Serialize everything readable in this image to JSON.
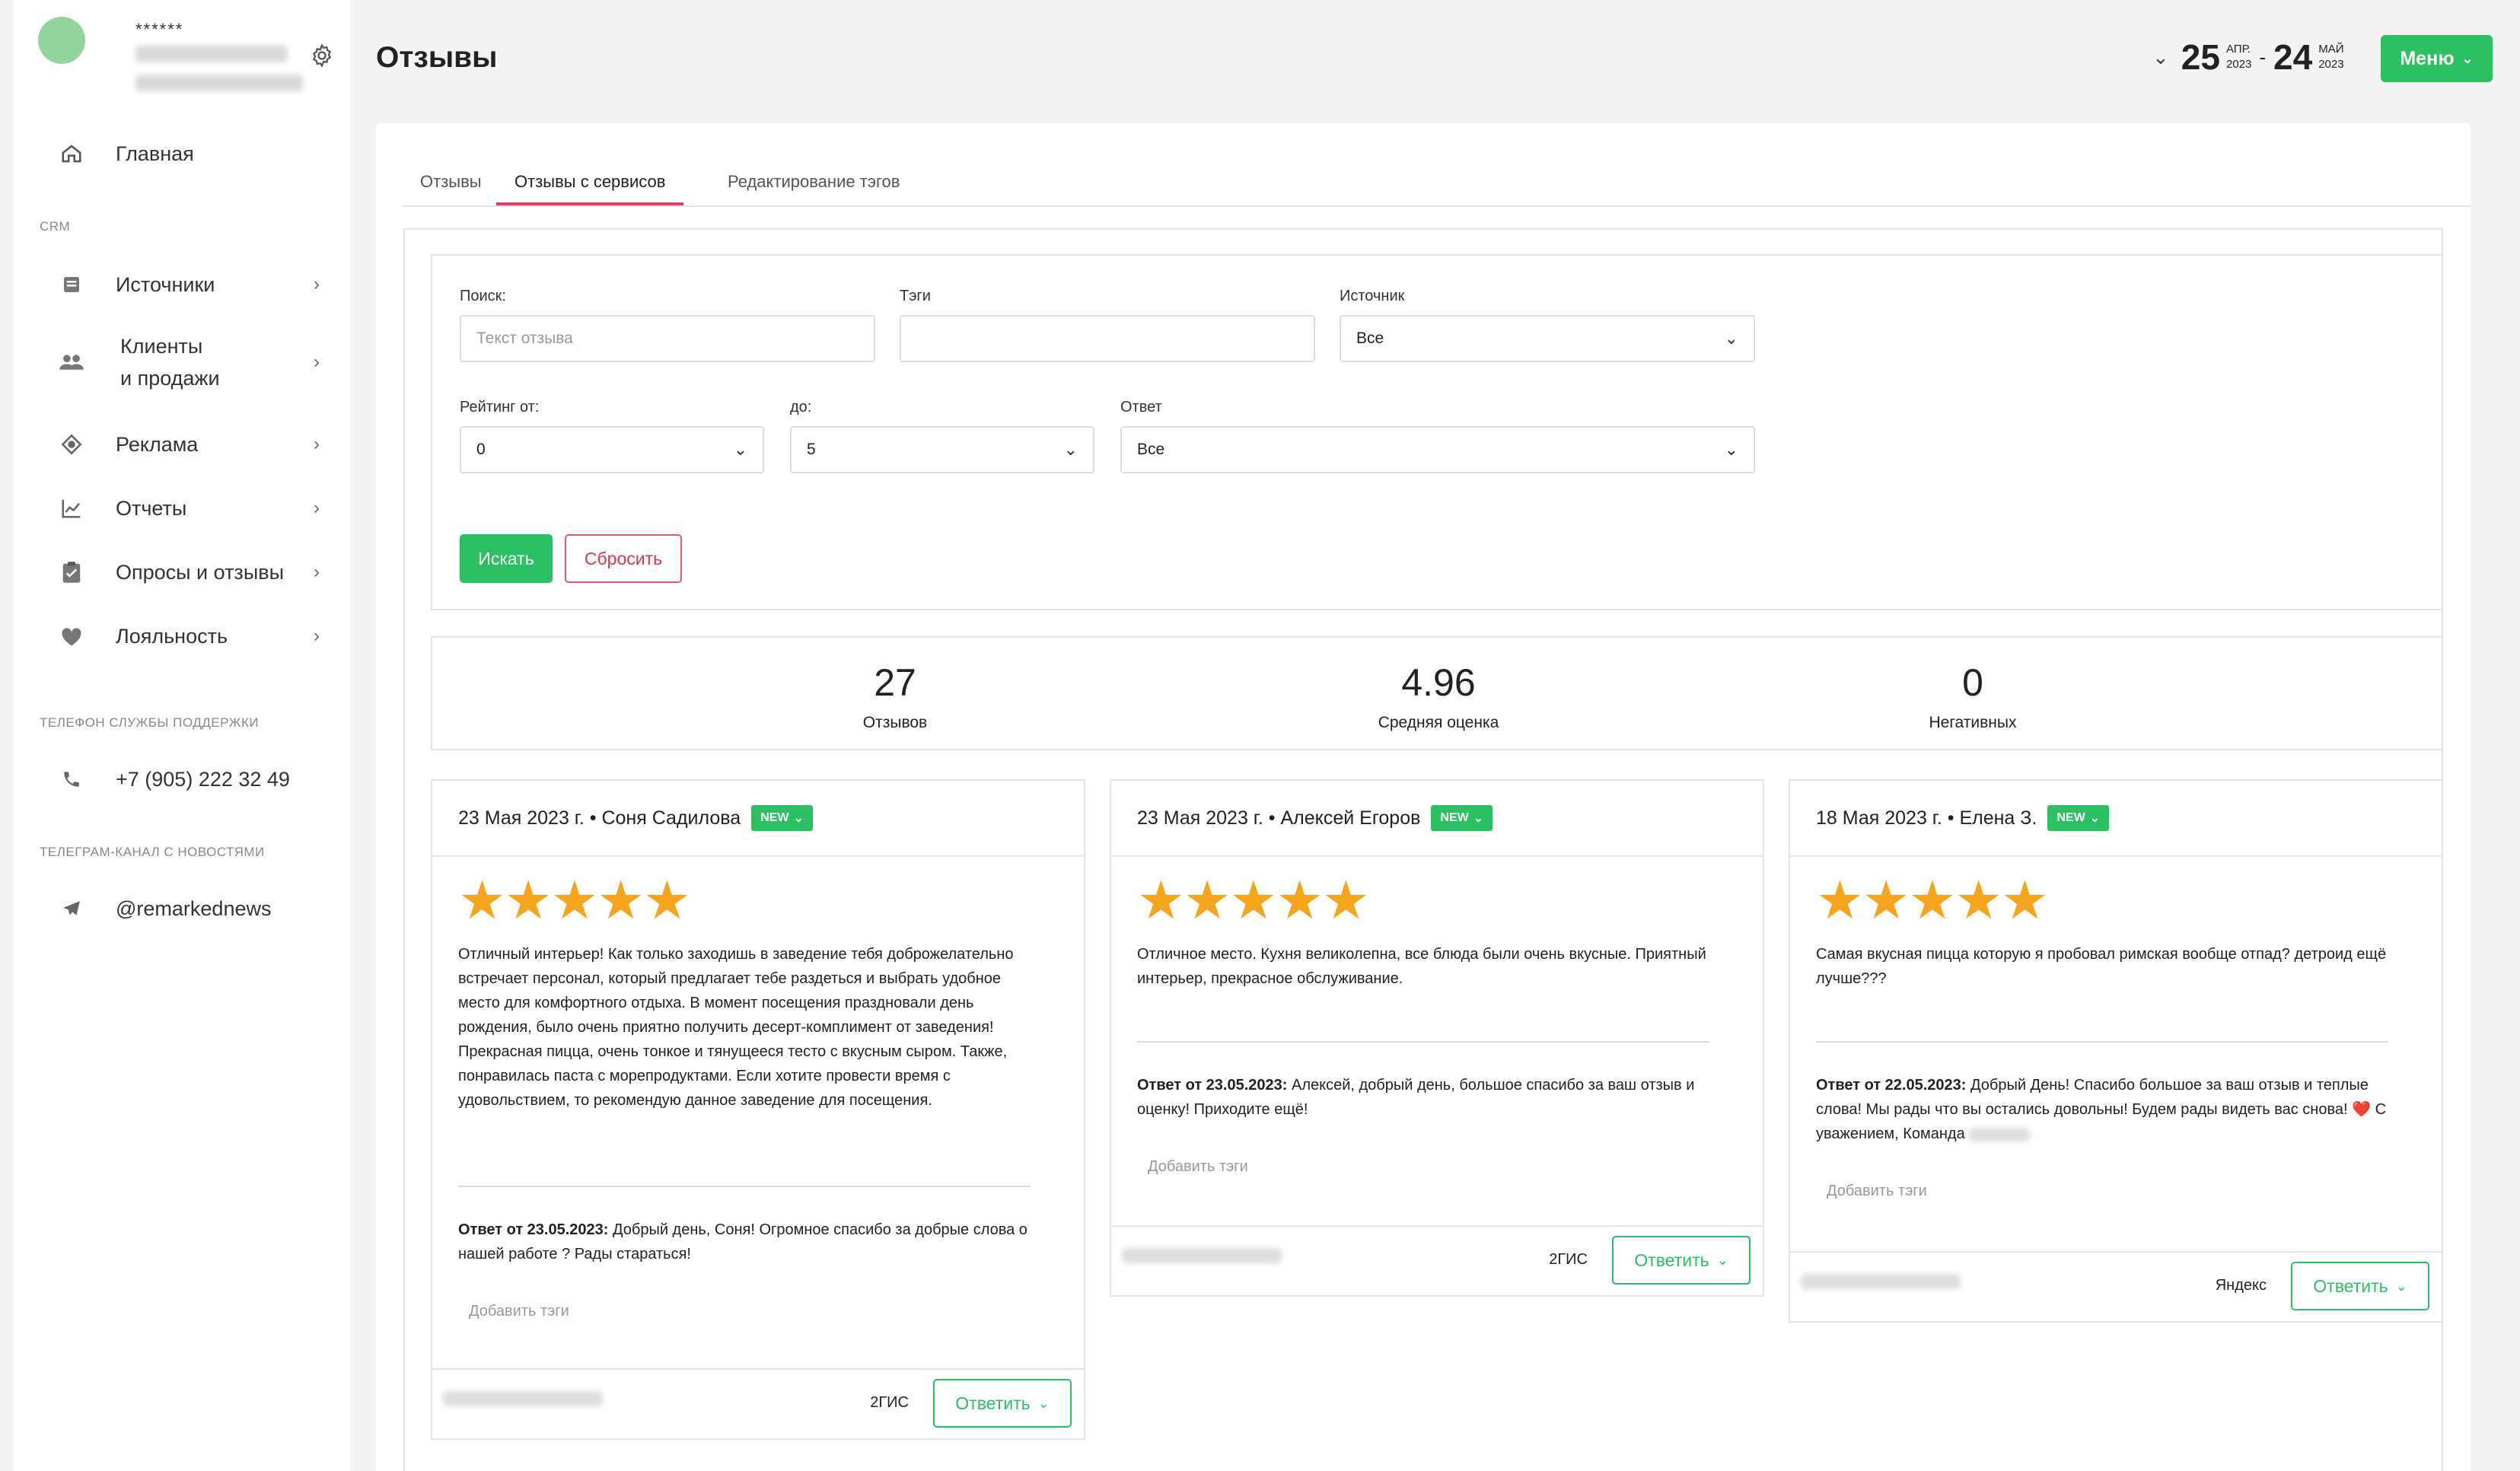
{
  "sidebar": {
    "user_mask": "******",
    "items": [
      {
        "label": "Главная",
        "icon": "home-icon"
      },
      {
        "label": "Источники",
        "icon": "sources-icon"
      },
      {
        "label": "Клиенты\nи продажи",
        "icon": "clients-icon"
      },
      {
        "label": "Реклама",
        "icon": "ads-icon"
      },
      {
        "label": "Отчеты",
        "icon": "reports-icon"
      },
      {
        "label": "Опросы и отзывы",
        "icon": "surveys-icon"
      },
      {
        "label": "Лояльность",
        "icon": "heart-icon"
      }
    ],
    "crm_section": "CRM",
    "support_section": "ТЕЛЕФОН СЛУЖБЫ ПОДДЕРЖКИ",
    "support_phone": "+7 (905) 222 32 49",
    "news_section": "ТЕЛЕГРАМ-КАНАЛ С НОВОСТЯМИ",
    "news_channel": "@remarkednews"
  },
  "header": {
    "title": "Отзывы",
    "date_from_day": "25",
    "date_from_month": "АПР.",
    "date_from_year": "2023",
    "date_dash": "-",
    "date_to_day": "24",
    "date_to_month": "МАЙ",
    "date_to_year": "2023",
    "menu_label": "Меню"
  },
  "tabs": [
    "Отзывы",
    "Отзывы с сервисов",
    "Редактирование тэгов"
  ],
  "filters": {
    "search_label": "Поиск:",
    "search_placeholder": "Текст отзыва",
    "tags_label": "Тэги",
    "source_label": "Источник",
    "source_value": "Все",
    "rating_from_label": "Рейтинг от:",
    "rating_from_value": "0",
    "rating_to_label": "до:",
    "rating_to_value": "5",
    "answer_label": "Ответ",
    "answer_value": "Все",
    "search_button": "Искать",
    "reset_button": "Сбросить"
  },
  "stats": [
    {
      "value": "27",
      "caption": "Отзывов"
    },
    {
      "value": "4.96",
      "caption": "Средняя оценка"
    },
    {
      "value": "0",
      "caption": "Негативных"
    }
  ],
  "reviews": [
    {
      "header": "23 Мая 2023 г.  • Соня Садилова",
      "badge": "NEW",
      "rating": 5,
      "stars": "★★★★★",
      "text": "Отличный интерьер! Как только заходишь в заведение тебя доброжелательно встречает персонал, который предлагает тебе раздеться и выбрать удобное место для комфортного отдыха. В момент посещения праздновали день рождения, было очень приятно получить десерт-комплимент от заведения! Прекрасная пицца, очень тонкое и тянущееся тесто с вкусным сыром. Также, понравилась паста с морепродуктами. Если хотите провести время с удовольствием, то рекомендую данное заведение для посещения.",
      "answer_prefix": "Ответ от 23.05.2023:",
      "answer_text": " Добрый день, Соня! Огромное спасибо за добрые слова о нашей работе ? Рады стараться!",
      "add_tags": "Добавить тэги",
      "source": "2ГИС",
      "reply_label": "Ответить"
    },
    {
      "header": "23 Мая 2023 г.  • Алексей Егоров",
      "badge": "NEW",
      "rating": 5,
      "stars": "★★★★★",
      "text": "Отличное место. Кухня великолепна, все блюда были очень вкусные. Приятный интерьер, прекрасное обслуживание.",
      "answer_prefix": "Ответ от 23.05.2023:",
      "answer_text": " Алексей, добрый день, большое спасибо за ваш отзыв и оценку! Приходите ещё!",
      "add_tags": "Добавить тэги",
      "source": "2ГИС",
      "reply_label": "Ответить"
    },
    {
      "header": "18 Мая 2023 г.  • Елена З.",
      "badge": "NEW",
      "rating": 5,
      "stars": "★★★★★",
      "text": "Самая вкусная пицца которую я пробовал римская вообще отпад? детроид ещё лучше???",
      "answer_prefix": "Ответ от 22.05.2023:",
      "answer_text": " Добрый День! Спасибо большое за ваш отзыв и теплые слова! Мы рады что вы остались довольны! Будем рады видеть вас снова! ",
      "answer_heart": "❤️",
      "answer_tail": " С уважением, Команда ",
      "add_tags": "Добавить тэги",
      "source": "Яндекс",
      "reply_label": "Ответить"
    }
  ],
  "colors": {
    "accent_green": "#2bc062",
    "accent_red": "#e83a5c",
    "star": "#f7a41d"
  }
}
